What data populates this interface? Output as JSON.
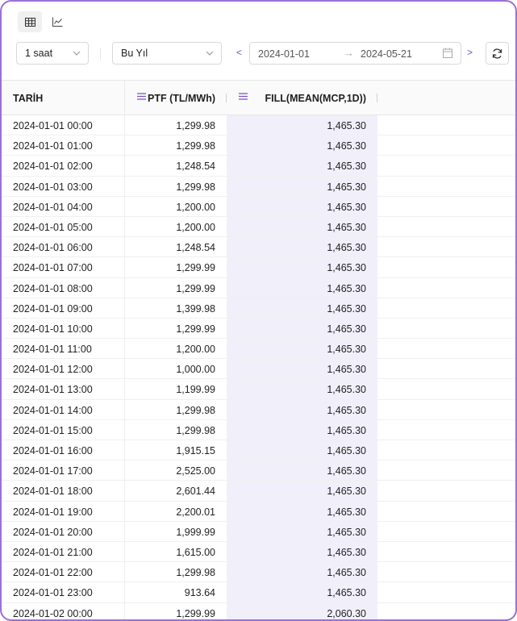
{
  "view_toggle": {
    "table_icon": "table-icon",
    "chart_icon": "line-chart-icon"
  },
  "toolbar": {
    "interval": "1 saat",
    "period": "Bu Yıl",
    "prev": "<",
    "next": ">",
    "date_from": "2024-01-01",
    "date_arrow": "→",
    "date_to": "2024-05-21",
    "calendar_icon": "calendar-icon",
    "refresh_icon": "refresh-icon"
  },
  "table": {
    "columns": [
      "TARİH",
      "PTF (TL/MWh)",
      "FILL(MEAN(MCP,1D))"
    ],
    "rows": [
      [
        "2024-01-01 00:00",
        "1,299.98",
        "1,465.30"
      ],
      [
        "2024-01-01 01:00",
        "1,299.98",
        "1,465.30"
      ],
      [
        "2024-01-01 02:00",
        "1,248.54",
        "1,465.30"
      ],
      [
        "2024-01-01 03:00",
        "1,299.98",
        "1,465.30"
      ],
      [
        "2024-01-01 04:00",
        "1,200.00",
        "1,465.30"
      ],
      [
        "2024-01-01 05:00",
        "1,200.00",
        "1,465.30"
      ],
      [
        "2024-01-01 06:00",
        "1,248.54",
        "1,465.30"
      ],
      [
        "2024-01-01 07:00",
        "1,299.99",
        "1,465.30"
      ],
      [
        "2024-01-01 08:00",
        "1,299.99",
        "1,465.30"
      ],
      [
        "2024-01-01 09:00",
        "1,399.98",
        "1,465.30"
      ],
      [
        "2024-01-01 10:00",
        "1,299.99",
        "1,465.30"
      ],
      [
        "2024-01-01 11:00",
        "1,200.00",
        "1,465.30"
      ],
      [
        "2024-01-01 12:00",
        "1,000.00",
        "1,465.30"
      ],
      [
        "2024-01-01 13:00",
        "1,199.99",
        "1,465.30"
      ],
      [
        "2024-01-01 14:00",
        "1,299.98",
        "1,465.30"
      ],
      [
        "2024-01-01 15:00",
        "1,299.98",
        "1,465.30"
      ],
      [
        "2024-01-01 16:00",
        "1,915.15",
        "1,465.30"
      ],
      [
        "2024-01-01 17:00",
        "2,525.00",
        "1,465.30"
      ],
      [
        "2024-01-01 18:00",
        "2,601.44",
        "1,465.30"
      ],
      [
        "2024-01-01 19:00",
        "2,200.01",
        "1,465.30"
      ],
      [
        "2024-01-01 20:00",
        "1,999.99",
        "1,465.30"
      ],
      [
        "2024-01-01 21:00",
        "1,615.00",
        "1,465.30"
      ],
      [
        "2024-01-01 22:00",
        "1,299.98",
        "1,465.30"
      ],
      [
        "2024-01-01 23:00",
        "913.64",
        "1,465.30"
      ],
      [
        "2024-01-02 00:00",
        "1,299.99",
        "2,060.30"
      ]
    ]
  },
  "colors": {
    "accent": "#7a4fc8",
    "frame_border": "#9b6fd8",
    "highlight_column": "#f1effa"
  }
}
